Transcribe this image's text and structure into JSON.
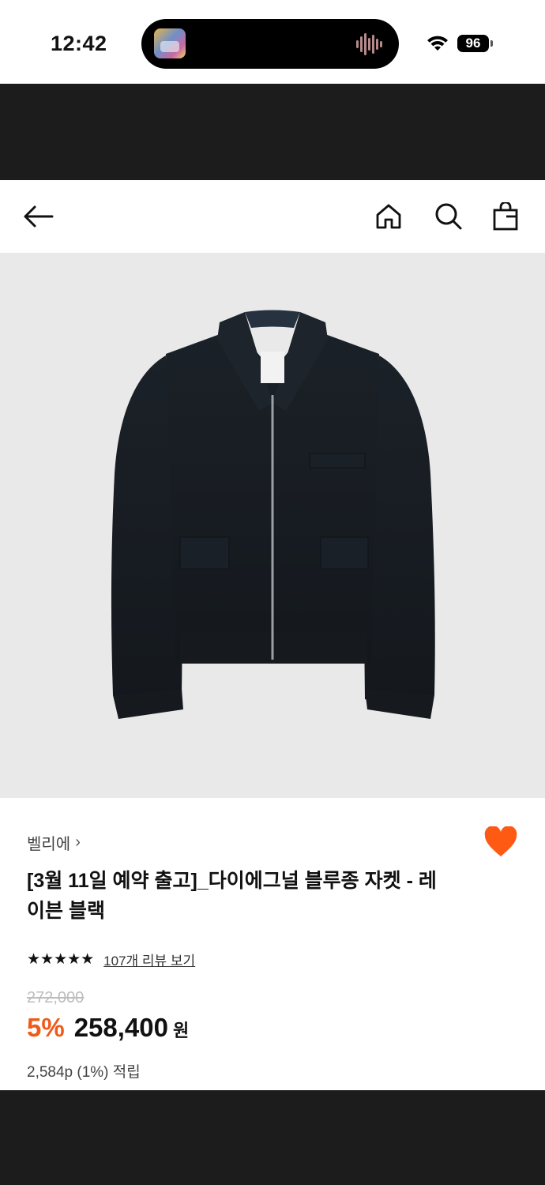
{
  "status_bar": {
    "time": "12:42",
    "battery": "96",
    "icons": [
      "wifi-icon",
      "battery-icon",
      "audio-wave-icon"
    ]
  },
  "nav": {
    "icons": [
      "back-arrow-icon",
      "home-icon",
      "search-icon",
      "shopping-bag-icon"
    ]
  },
  "product": {
    "image": "black-zip-up-blouson-jacket",
    "brand": "벨리에",
    "brand_chevron": "›",
    "title_line1": "[3월 11일 예약 출고]_다이에그널 블루종 자켓 - 레",
    "title_line2": "이븐 블랙",
    "stars": "★★★★★",
    "rating_value": 5,
    "review_link": "107개 리뷰 보기",
    "original_price": "272,000",
    "discount": "5%",
    "price": "258,400",
    "currency": "원",
    "points": "2,584p (1%) 적립",
    "liked": true
  },
  "colors": {
    "accent": "#ee5a1a",
    "heart": "#ff5a14",
    "dark_band": "#1c1c1c",
    "image_bg": "#e9e9e9"
  }
}
